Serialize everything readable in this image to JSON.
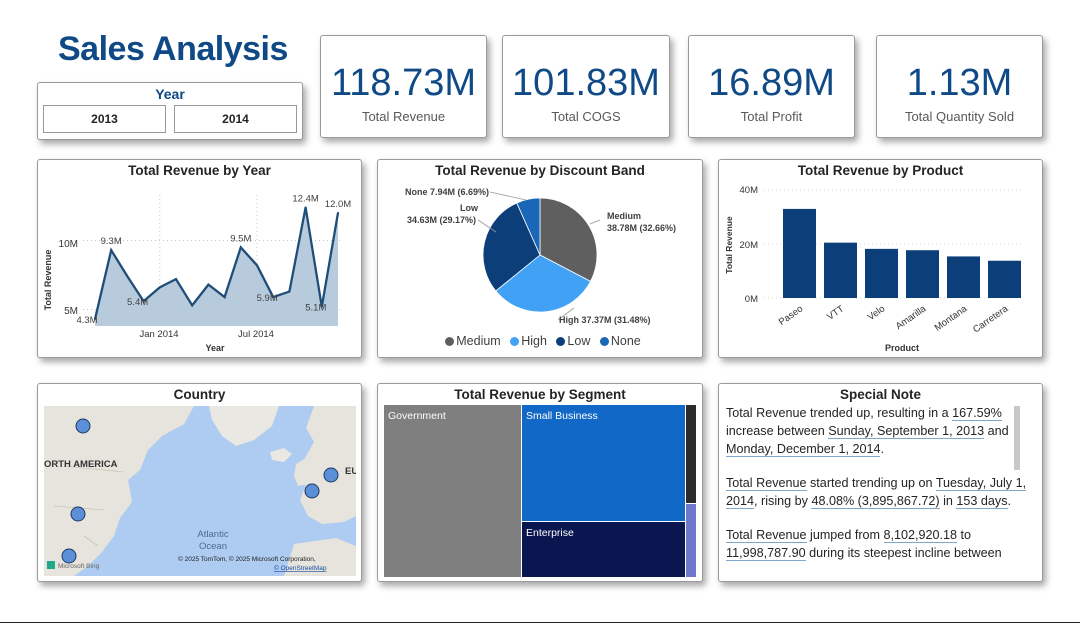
{
  "header": {
    "title": "Sales Analysis"
  },
  "slicer": {
    "title": "Year",
    "options": [
      "2013",
      "2014"
    ]
  },
  "kpis": [
    {
      "value": "118.73M",
      "label": "Total Revenue"
    },
    {
      "value": "101.83M",
      "label": "Total COGS"
    },
    {
      "value": "16.89M",
      "label": "Total Profit"
    },
    {
      "value": "1.13M",
      "label": "Total Quantity Sold"
    }
  ],
  "chart_data": [
    {
      "type": "area",
      "title": "Total Revenue by Year",
      "xlabel": "Year",
      "ylabel": "Total Revenue",
      "x_ticks": [
        "Jan 2014",
        "Jul 2014"
      ],
      "y_ticks": [
        "5M",
        "10M"
      ],
      "x": [
        "2013-09",
        "2013-10",
        "2013-11",
        "2013-12",
        "2014-01",
        "2014-02",
        "2014-03",
        "2014-04",
        "2014-05",
        "2014-06",
        "2014-07",
        "2014-08",
        "2014-09",
        "2014-10",
        "2014-11",
        "2014-12"
      ],
      "values": [
        4.3,
        9.3,
        7.4,
        5.6,
        6.6,
        7.2,
        5.3,
        6.8,
        5.9,
        9.5,
        8.2,
        5.9,
        6.3,
        12.4,
        5.2,
        12.0
      ],
      "data_labels": [
        "4.3M",
        "9.3M",
        "5.4M",
        "9.5M",
        "5.9M",
        "12.4M",
        "5.1M",
        "12.0M"
      ],
      "color": "#1f4e79"
    },
    {
      "type": "pie",
      "title": "Total Revenue by Discount Band",
      "slices": [
        {
          "name": "Medium",
          "value": 38.78,
          "percent": 32.66,
          "label": "Medium\n38.78M (32.66%)",
          "color": "#5f5f5f"
        },
        {
          "name": "High",
          "value": 37.37,
          "percent": 31.48,
          "label": "High 37.37M (31.48%)",
          "color": "#41a1f5"
        },
        {
          "name": "Low",
          "value": 34.63,
          "percent": 29.17,
          "label": "Low\n34.63M (29.17%)",
          "color": "#0c3f7a"
        },
        {
          "name": "None",
          "value": 7.94,
          "percent": 6.69,
          "label": "None 7.94M (6.69%)",
          "color": "#1a67b8"
        }
      ],
      "legend": [
        "Medium",
        "High",
        "Low",
        "None"
      ]
    },
    {
      "type": "bar",
      "title": "Total Revenue by Product",
      "xlabel": "Product",
      "ylabel": "Total Revenue",
      "categories": [
        "Paseo",
        "VTT",
        "Velo",
        "Amarilla",
        "Montana",
        "Carretera"
      ],
      "values": [
        33.0,
        20.5,
        18.2,
        17.7,
        15.4,
        13.8
      ],
      "y_ticks": [
        "0M",
        "20M",
        "40M"
      ],
      "ylim": [
        0,
        40
      ],
      "color": "#0c3f7a"
    },
    {
      "type": "treemap",
      "title": "Total Revenue by Segment",
      "items": [
        {
          "name": "Government",
          "color": "#7f7f7f"
        },
        {
          "name": "Small Business",
          "color": "#1268c6"
        },
        {
          "name": "Enterprise",
          "color": "#0a1650"
        }
      ]
    }
  ],
  "map": {
    "title": "Country",
    "labels": {
      "north_america": "ORTH AMERICA",
      "europe": "EU",
      "ocean1": "Atlantic",
      "ocean2": "Ocean"
    },
    "attribution": "© 2025 TomTom, © 2025 Microsoft Corporation,",
    "osm": "© OpenStreetMap",
    "logo": "Microsoft Bing"
  },
  "note": {
    "title": "Special Note",
    "p1": {
      "a": "Total Revenue trended up, resulting in a ",
      "b": "167.59%",
      "c": " increase between ",
      "d": "Sunday, September 1, 2013",
      "e": " and ",
      "f": "Monday, December 1, 2014",
      "g": "."
    },
    "p2": {
      "a": "Total Revenue",
      "b": " started trending up on ",
      "c": "Tuesday, July 1, 2014",
      "d": ", rising by ",
      "e": "48.08%",
      "f": " (3,895,867.72)",
      "g": " in ",
      "h": "153 days",
      "i": "."
    },
    "p3": {
      "a": "Total Revenue",
      "b": " jumped from ",
      "c": "8,102,920.18",
      "d": " to ",
      "e": "11,998,787.90",
      "f": " during its steepest incline between"
    }
  }
}
